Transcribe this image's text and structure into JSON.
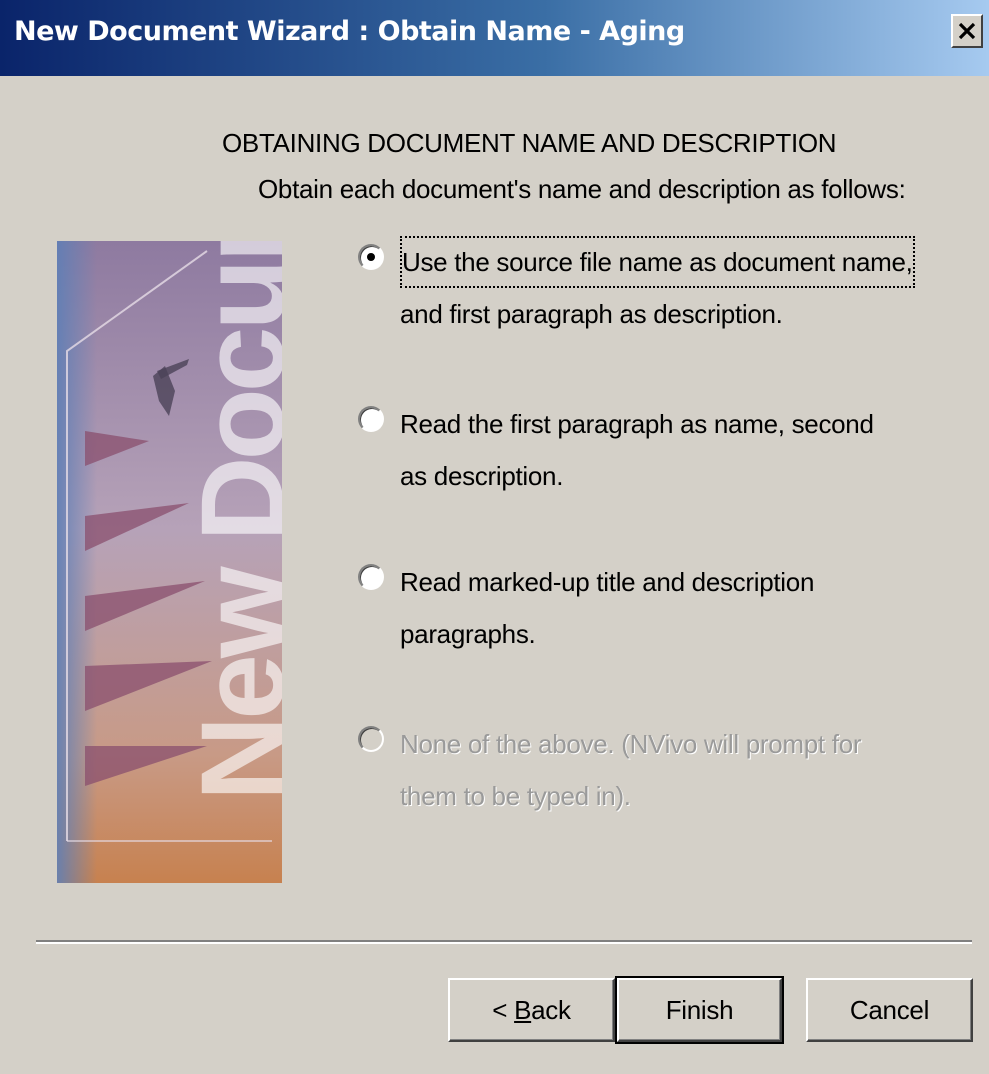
{
  "window": {
    "title": "New Document Wizard : Obtain Name - Aging",
    "close_label": "X"
  },
  "page": {
    "heading": "OBTAINING DOCUMENT NAME AND DESCRIPTION",
    "subheading": "Obtain each document's name and description as follows:"
  },
  "banner": {
    "text": "New Document",
    "colors": {
      "top": "#9d8aa8",
      "middle": "#b7a3b8",
      "bottom": "#c9916e",
      "edge": "#6b86b6"
    }
  },
  "options": [
    {
      "line1": "Use the source file name as document name,",
      "line2": "and first paragraph as description.",
      "selected": true,
      "enabled": true
    },
    {
      "line1": "Read the first paragraph as name, second",
      "line2": "as description.",
      "selected": false,
      "enabled": true
    },
    {
      "line1": "Read marked-up title and description",
      "line2": "paragraphs.",
      "selected": false,
      "enabled": true
    },
    {
      "line1": "None of the above. (NVivo will prompt for",
      "line2": "them to be typed in).",
      "selected": false,
      "enabled": false
    }
  ],
  "buttons": {
    "back_prefix": "< ",
    "back_mnemonic": "B",
    "back_rest": "ack",
    "finish": "Finish",
    "cancel": "Cancel"
  }
}
